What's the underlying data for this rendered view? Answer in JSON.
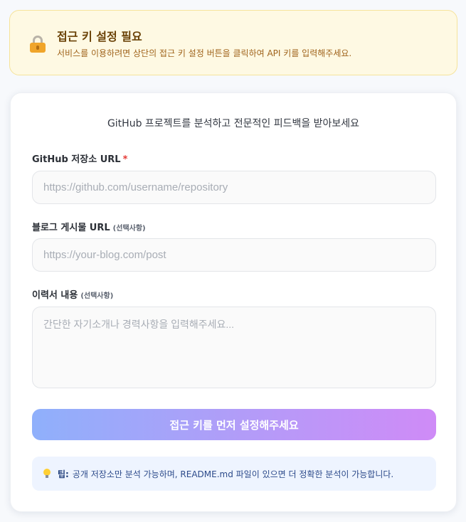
{
  "notice": {
    "icon": "lock-icon",
    "title": "접근 키 설정 필요",
    "description": "서비스를 이용하려면 상단의 접근 키 설정 버튼을 클릭하여 API 키를 입력해주세요."
  },
  "form": {
    "subtitle": "GitHub 프로젝트를 분석하고 전문적인 피드백을 받아보세요",
    "repo": {
      "label": "GitHub 저장소 URL",
      "required_mark": "*",
      "placeholder": "https://github.com/username/repository",
      "value": ""
    },
    "blog": {
      "label": "블로그 게시물 URL",
      "optional_note": "(선택사항)",
      "placeholder": "https://your-blog.com/post",
      "value": ""
    },
    "resume": {
      "label": "이력서 내용",
      "optional_note": "(선택사항)",
      "placeholder": "간단한 자기소개나 경력사항을 입력해주세요...",
      "value": ""
    },
    "submit_label": "접근 키를 먼저 설정해주세요"
  },
  "tip": {
    "icon": "lightbulb-icon",
    "label": "팁:",
    "text": "공개 저장소만 분석 가능하며, README.md 파일이 있으면 더 정확한 분석이 가능합니다."
  },
  "colors": {
    "notice_bg": "#fef9e3",
    "notice_title": "#6b4308",
    "required": "#e53935",
    "button_gradient_start": "#8fb0fb",
    "button_gradient_end": "#cf8bf7",
    "tip_bg": "#eef4ff"
  }
}
